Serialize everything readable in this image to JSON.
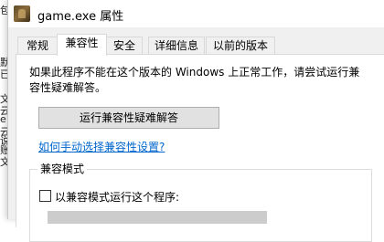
{
  "window": {
    "title": "game.exe 属性"
  },
  "background_strip": {
    "texts": [
      "包",
      "默",
      "已",
      "文",
      "云",
      "e",
      "云",
      "说",
      "账",
      "文"
    ]
  },
  "tabs": [
    {
      "label": "常规",
      "active": false
    },
    {
      "label": "兼容性",
      "active": true
    },
    {
      "label": "安全",
      "active": false
    },
    {
      "label": "详细信息",
      "active": false
    },
    {
      "label": "以前的版本",
      "active": false
    }
  ],
  "compat": {
    "description": "如果此程序不能在这个版本的 Windows 上正常工作，请尝试运行兼容性疑难解答。",
    "run_troubleshooter_label": "运行兼容性疑难解答",
    "manual_link": "如何手动选择兼容性设置?",
    "mode_group_label": "兼容模式",
    "mode_checkbox_label": "以兼容模式运行这个程序:",
    "mode_checkbox_checked": false
  },
  "colors": {
    "link": "#0066cc",
    "button_bg": "#e1e1e1",
    "client_bg": "#f0f0f0"
  }
}
